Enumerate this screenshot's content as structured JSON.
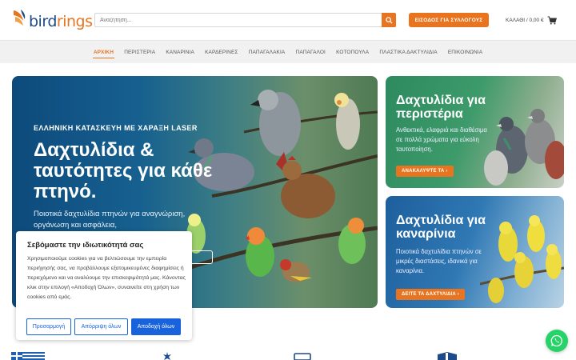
{
  "header": {
    "logo_text_a": "bird",
    "logo_text_b": "rings",
    "search_placeholder": "Αναζήτηση...",
    "login_label": "ΕΙΣΟΔΟΣ ΓΙΑ ΣΥΛΛΟΓΟΥΣ",
    "cart_label": "ΚΑΛΑΘΙ / 0,00 €"
  },
  "nav": {
    "items": [
      "ΑΡΧΙΚΗ",
      "ΠΕΡΙΣΤΕΡΙΑ",
      "ΚΑΝΑΡΙΝΙΑ",
      "ΚΑΡΔΕΡΙΝΕΣ",
      "ΠΑΠΑΓΑΛΑΚΙΑ",
      "ΠΑΠΑΓΑΛΟΙ",
      "ΚΟΤΟΠΟΥΛΑ",
      "ΠΛΑΣΤΙΚΑ ΔΑΚΤΥΛΙΔΙΑ",
      "ΕΠΙΚΟΙΝΩΝΙΑ"
    ],
    "active": "ΑΡΧΙΚΗ"
  },
  "hero": {
    "eyebrow": "ΕΛΛΗΝΙΚΗ ΚΑΤΑΣΚΕΥΗ ΜΕ ΧΑΡΑΞΗ LASER",
    "title": "Δαχτυλίδια & ταυτότητες για κάθε πτηνό.",
    "subtitle": "Ποιοτικά δαχτυλίδια πτηνών για αναγνώριση, οργάνωση και ασφάλεια,"
  },
  "cards": [
    {
      "title": "Δαχτυλίδια για περιστέρια",
      "text": "Ανθεκτικά, ελαφριά και διαθέσιμα σε πολλά χρώματα για εύκολη ταυτοποίηση.",
      "button": "ΑΝΑΚΑΛΥΨΤΕ ΤΑ ›"
    },
    {
      "title": "Δαχτυλίδια για καναρίνια",
      "text": "Ποιοτικά δαχτυλίδια πτηνών σε μικρές διαστάσεις, ιδανικά για καναρίνια.",
      "button": "ΔΕΙΤΕ ΤΑ ΔΑΧΤΥΛΙΔΙΑ ›"
    }
  ],
  "cookie": {
    "title": "Σεβόμαστε την ιδιωτικότητά σας",
    "body": "Χρησιμοποιούμε cookies για να βελτιώσουμε την εμπειρία περιήγησής σας, να προβάλλουμε εξατομικευμένες διαφημίσεις ή περιεχόμενο και να αναλύουμε την επισκεψιμότητά μας. Κάνοντας κλικ στην επιλογή «Αποδοχή Όλων», συναινείτε στη χρήση των cookies από εμάς.",
    "customize": "Προσαρμογή",
    "reject": "Απόρριψη όλων",
    "accept": "Αποδοχή όλων"
  },
  "colors": {
    "accent": "#e8741f",
    "brand_blue": "#1c4a8a",
    "cookie_blue": "#1863dc",
    "whatsapp": "#25d366"
  },
  "icons": [
    "search-icon",
    "cart-icon",
    "whatsapp-icon",
    "greek-flag-icon"
  ]
}
